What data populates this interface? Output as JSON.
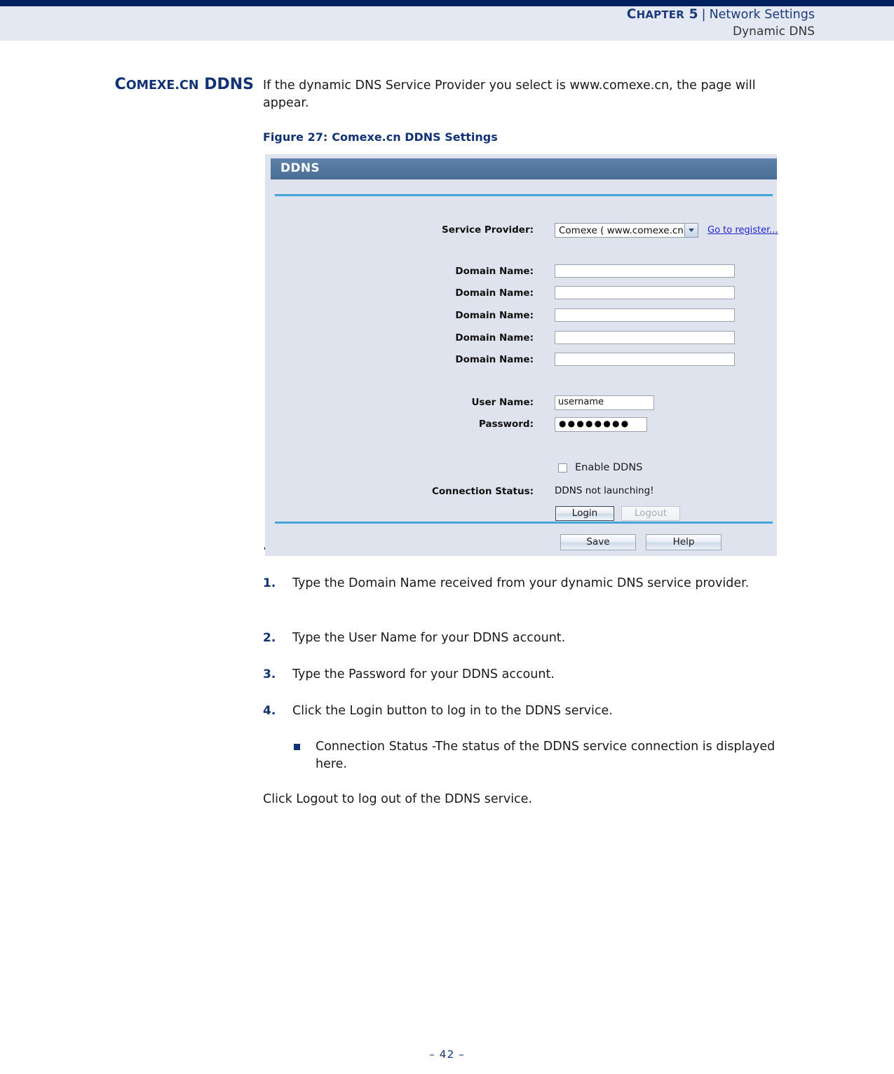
{
  "header": {
    "chapter_label": "Chapter 5",
    "chapter_cap": "C",
    "chapter_rest": "HAPTER",
    "chapter_num": " 5",
    "separator": "|",
    "section": "Network Settings",
    "subsection": "Dynamic DNS"
  },
  "side_heading": {
    "part1_cap": "C",
    "part1_small": "OMEXE",
    "part2_dot": ".",
    "part2_small": "CN",
    "part3": "DDNS",
    "full": "Comexe.cn DDNS"
  },
  "intro": "If the dynamic DNS Service Provider you select is www.comexe.cn, the page will appear.",
  "figure": {
    "caption_number": "Figure 27:",
    "caption_title": "Comexe.cn DDNS Settings",
    "panel_title": "DDNS",
    "stray_mark": ".",
    "service_provider": {
      "label": "Service Provider:",
      "value": "Comexe ( www.comexe.cn )",
      "register_link": "Go to register..."
    },
    "domain_rows": [
      {
        "label": "Domain Name:",
        "value": ""
      },
      {
        "label": "Domain Name:",
        "value": ""
      },
      {
        "label": "Domain Name:",
        "value": ""
      },
      {
        "label": "Domain Name:",
        "value": ""
      },
      {
        "label": "Domain Name:",
        "value": ""
      }
    ],
    "user_name": {
      "label": "User Name:",
      "value": "username"
    },
    "password": {
      "label": "Password:",
      "value": "●●●●●●●●"
    },
    "enable_ddns": {
      "label": "Enable DDNS",
      "checked": false
    },
    "connection_status": {
      "label": "Connection Status:",
      "value": "DDNS not launching!"
    },
    "login_button": "Login",
    "logout_button": "Logout",
    "save_button": "Save",
    "help_button": "Help",
    "colors": {
      "title_bar": "#4f7299",
      "panel_bg": "#dfe3ee",
      "rule": "#3aa8e0",
      "link": "#2424cc"
    }
  },
  "steps": [
    {
      "number": "1.",
      "text": "Type the Domain Name received from your dynamic DNS service provider."
    },
    {
      "number": "2.",
      "text": "Type the User Name for your DDNS account."
    },
    {
      "number": "3.",
      "text": "Type the Password for your DDNS account."
    },
    {
      "number": "4.",
      "text": "Click the Login button to log in to the DDNS service."
    }
  ],
  "bullet": "Connection Status -The status of the DDNS service connection is displayed here.",
  "tail_paragraph": "Click Logout to log out of the DDNS service.",
  "footer": "–  42  –",
  "theme": {
    "navy": "#002060",
    "header_band": "#e4e8f2",
    "heading_blue": "#123274"
  }
}
